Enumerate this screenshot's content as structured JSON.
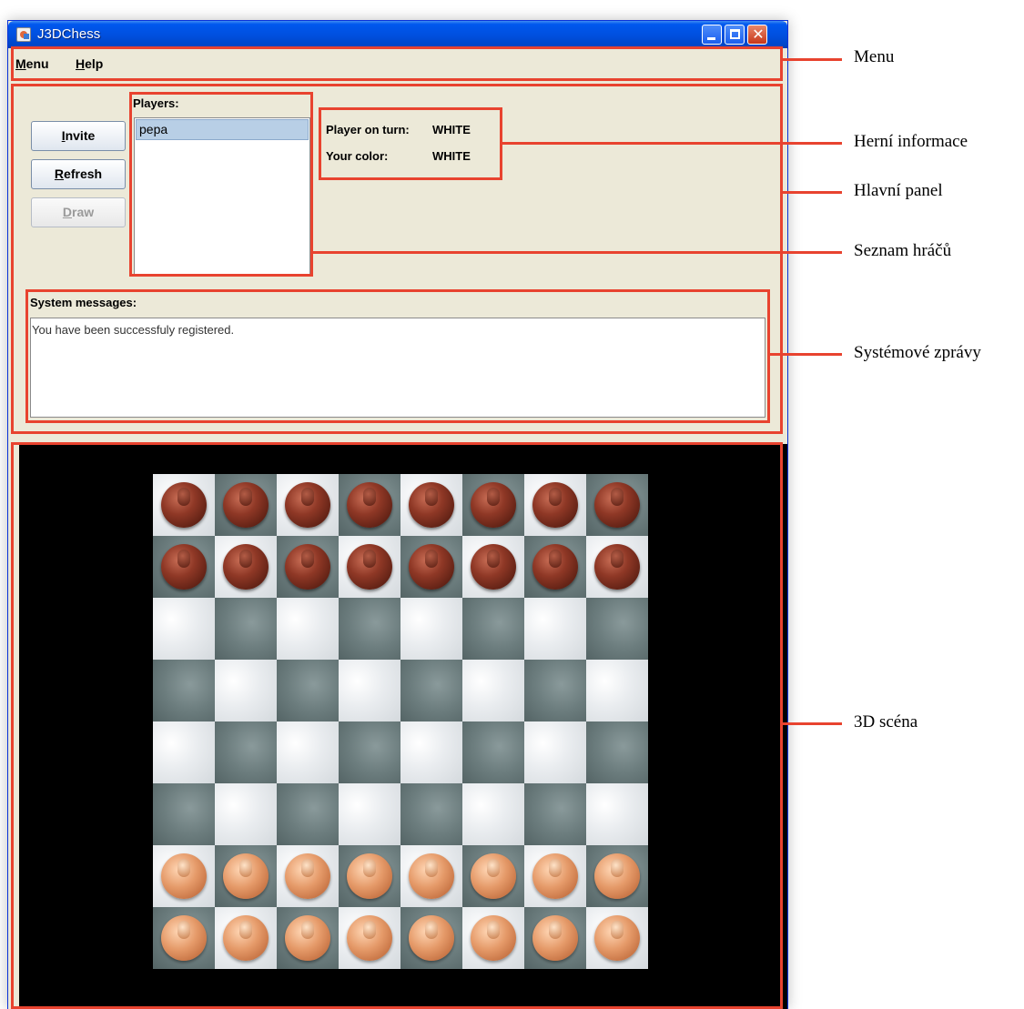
{
  "window": {
    "title": "J3DChess"
  },
  "menubar": {
    "items": [
      {
        "label_ul": "M",
        "label_rest": "enu"
      },
      {
        "label_ul": "H",
        "label_rest": "elp"
      }
    ]
  },
  "main_panel": {
    "buttons": {
      "invite": {
        "label_ul": "I",
        "label_rest": "nvite",
        "enabled": true
      },
      "refresh": {
        "label_ul": "R",
        "label_rest": "efresh",
        "enabled": true
      },
      "draw": {
        "label_ul": "D",
        "label_rest": "raw",
        "enabled": false
      }
    },
    "players_label": "Players:",
    "players": [
      "pepa"
    ],
    "game_info": {
      "turn_label": "Player on turn:",
      "turn_value": "WHITE",
      "color_label": "Your color:",
      "color_value": "WHITE"
    },
    "system_messages_label": "System messages:",
    "system_messages": [
      "You have been successfuly registered."
    ]
  },
  "annotations": [
    "Menu",
    "Herní informace",
    "Hlavní panel",
    "Seznam hráčů",
    "Systémové zprávy",
    "3D scéna"
  ],
  "colors": {
    "annotation_red": "#e8432f",
    "window_bg": "#ECE9D8",
    "titlebar_blue": "#0050e0",
    "selection_blue": "#b8cfe6"
  },
  "board": {
    "size": 8,
    "black_pieces_rows": [
      0,
      1
    ],
    "white_pieces_rows": [
      6,
      7
    ]
  }
}
